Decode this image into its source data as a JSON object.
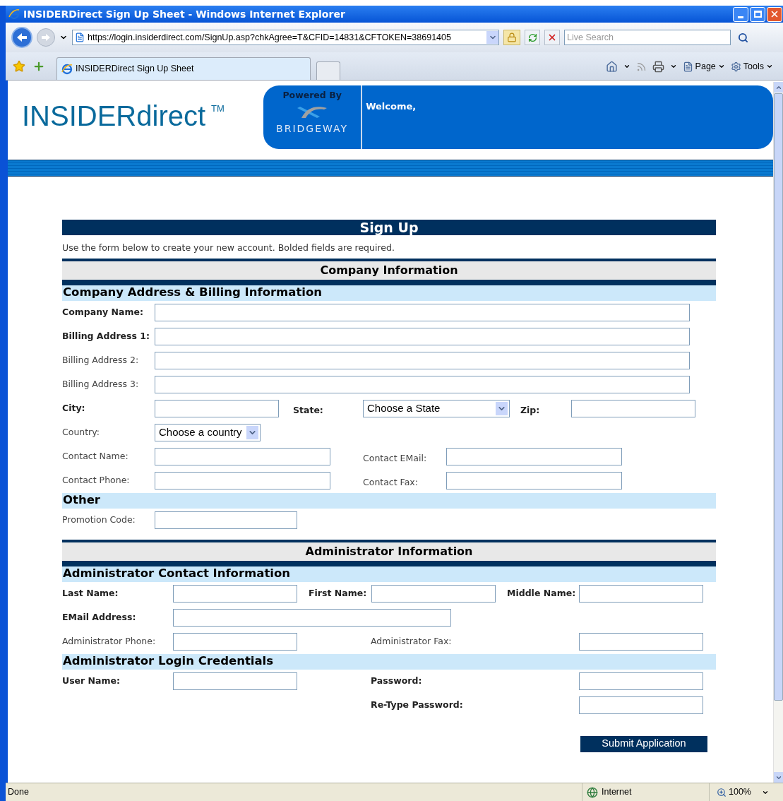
{
  "window": {
    "title": "INSIDERDirect Sign Up Sheet - Windows Internet Explorer"
  },
  "address_bar": {
    "url": "https://login.insiderdirect.com/SignUp.asp?chkAgree=T&CFID=14831&CFTOKEN=38691405",
    "search_placeholder": "Live Search"
  },
  "tab": {
    "label": "INSIDERDirect Sign Up Sheet",
    "selected": true
  },
  "toolbar": [
    "Page",
    "Tools"
  ],
  "header": {
    "logo": "INSIDERdirect",
    "trademark": "TM",
    "powered_by": "Powered By",
    "partner": "BRIDGEWAY",
    "welcome": "Welcome,"
  },
  "form": {
    "title": "Sign Up",
    "intro": "Use the form below to create your new account. Bolded fields are required.",
    "sections": [
      {
        "kind": "banner",
        "title": "Company Information"
      },
      {
        "kind": "subhead",
        "title": "Company Address & Billing Information"
      },
      {
        "kind": "full",
        "cells": [
          {
            "label": "Company Name:",
            "required": true,
            "kind": "text"
          }
        ]
      },
      {
        "kind": "full",
        "cells": [
          {
            "label": "Billing Address 1:",
            "required": true,
            "kind": "text"
          }
        ]
      },
      {
        "kind": "full",
        "cells": [
          {
            "label": "Billing Address 2:",
            "required": false,
            "kind": "text"
          }
        ]
      },
      {
        "kind": "full",
        "cells": [
          {
            "label": "Billing Address 3:",
            "required": false,
            "kind": "text"
          }
        ]
      },
      {
        "kind": "city",
        "cells": [
          {
            "label": "City:",
            "required": true,
            "kind": "text"
          },
          {
            "label": "State:",
            "required": true,
            "kind": "select",
            "value": "Choose a State"
          },
          {
            "label": "Zip:",
            "required": true,
            "kind": "text"
          }
        ]
      },
      {
        "kind": "single",
        "cells": [
          {
            "label": "Country:",
            "required": false,
            "kind": "select",
            "value": "Choose a country"
          }
        ]
      },
      {
        "kind": "two",
        "cells": [
          {
            "label": "Contact Name:",
            "required": false,
            "kind": "text"
          },
          {
            "label": "Contact EMail:",
            "required": false,
            "kind": "text"
          }
        ]
      },
      {
        "kind": "two",
        "cells": [
          {
            "label": "Contact Phone:",
            "required": false,
            "kind": "text"
          },
          {
            "label": "Contact Fax:",
            "required": false,
            "kind": "text"
          }
        ]
      },
      {
        "kind": "subhead",
        "title": "Other"
      },
      {
        "kind": "single",
        "cells": [
          {
            "label": "Promotion Code:",
            "required": false,
            "kind": "text"
          }
        ]
      },
      {
        "kind": "banner",
        "title": "Administrator Information"
      },
      {
        "kind": "subhead",
        "title": "Administrator Contact Information"
      },
      {
        "kind": "triple",
        "cells": [
          {
            "label": "Last Name:",
            "required": true,
            "kind": "text"
          },
          {
            "label": "First Name:",
            "required": true,
            "kind": "text"
          },
          {
            "label": "Middle Name:",
            "required": true,
            "kind": "text"
          }
        ]
      },
      {
        "kind": "email",
        "cells": [
          {
            "label": "EMail Address:",
            "required": true,
            "kind": "text"
          }
        ]
      },
      {
        "kind": "pair",
        "cells": [
          {
            "label": "Administrator Phone:",
            "required": false,
            "kind": "text"
          },
          {
            "label": "Administrator Fax:",
            "required": false,
            "kind": "text"
          }
        ]
      },
      {
        "kind": "subhead",
        "title": "Administrator Login Credentials"
      },
      {
        "kind": "pair",
        "cells": [
          {
            "label": "User Name:",
            "required": true,
            "kind": "text"
          },
          {
            "label": "Password:",
            "required": true,
            "kind": "text"
          }
        ]
      },
      {
        "kind": "right",
        "cells": [
          {
            "label": "Re-Type Password:",
            "required": true,
            "kind": "text"
          }
        ]
      }
    ],
    "submit": "Submit Application"
  },
  "status_bar": {
    "text": "Done",
    "zone": "Internet",
    "zoom": "100%"
  }
}
